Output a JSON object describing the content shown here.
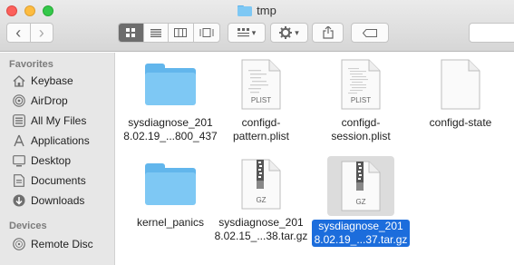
{
  "window": {
    "title": "tmp"
  },
  "toolbar": {
    "back_glyph": "‹",
    "forward_glyph": "›",
    "view_modes": [
      "icon-view-icon",
      "list-view-icon",
      "column-view-icon",
      "coverflow-view-icon"
    ],
    "active_view": "icon-view",
    "arrange_glyph": "▾",
    "action_glyph": "▾"
  },
  "sidebar": {
    "favorites_label": "Favorites",
    "favorites": [
      {
        "label": "Keybase",
        "icon": "house-icon"
      },
      {
        "label": "AirDrop",
        "icon": "airdrop-icon"
      },
      {
        "label": "All My Files",
        "icon": "all-files-icon"
      },
      {
        "label": "Applications",
        "icon": "applications-icon"
      },
      {
        "label": "Desktop",
        "icon": "desktop-icon"
      },
      {
        "label": "Documents",
        "icon": "documents-icon"
      },
      {
        "label": "Downloads",
        "icon": "downloads-icon"
      }
    ],
    "devices_label": "Devices",
    "devices": [
      {
        "label": "Remote Disc",
        "icon": "disc-icon"
      }
    ]
  },
  "files": [
    {
      "name": "sysdiagnose_201\n8.02.19_...800_437",
      "type": "folder"
    },
    {
      "name": "configd-\npattern.plist",
      "type": "doc",
      "tag": "PLIST"
    },
    {
      "name": "configd-\nsession.plist",
      "type": "doc",
      "tag": "PLIST"
    },
    {
      "name": "configd-state",
      "type": "doc",
      "tag": ""
    },
    {
      "name": "kernel_panics",
      "type": "folder"
    },
    {
      "name": "sysdiagnose_201\n8.02.15_...38.tar.gz",
      "type": "archive",
      "tag": "GZ"
    },
    {
      "name": "sysdiagnose_201\n8.02.19_...37.tar.gz",
      "type": "archive",
      "tag": "GZ",
      "selected": true
    }
  ],
  "colors": {
    "selection": "#1c6ddc",
    "folder": "#7ec8f4"
  }
}
